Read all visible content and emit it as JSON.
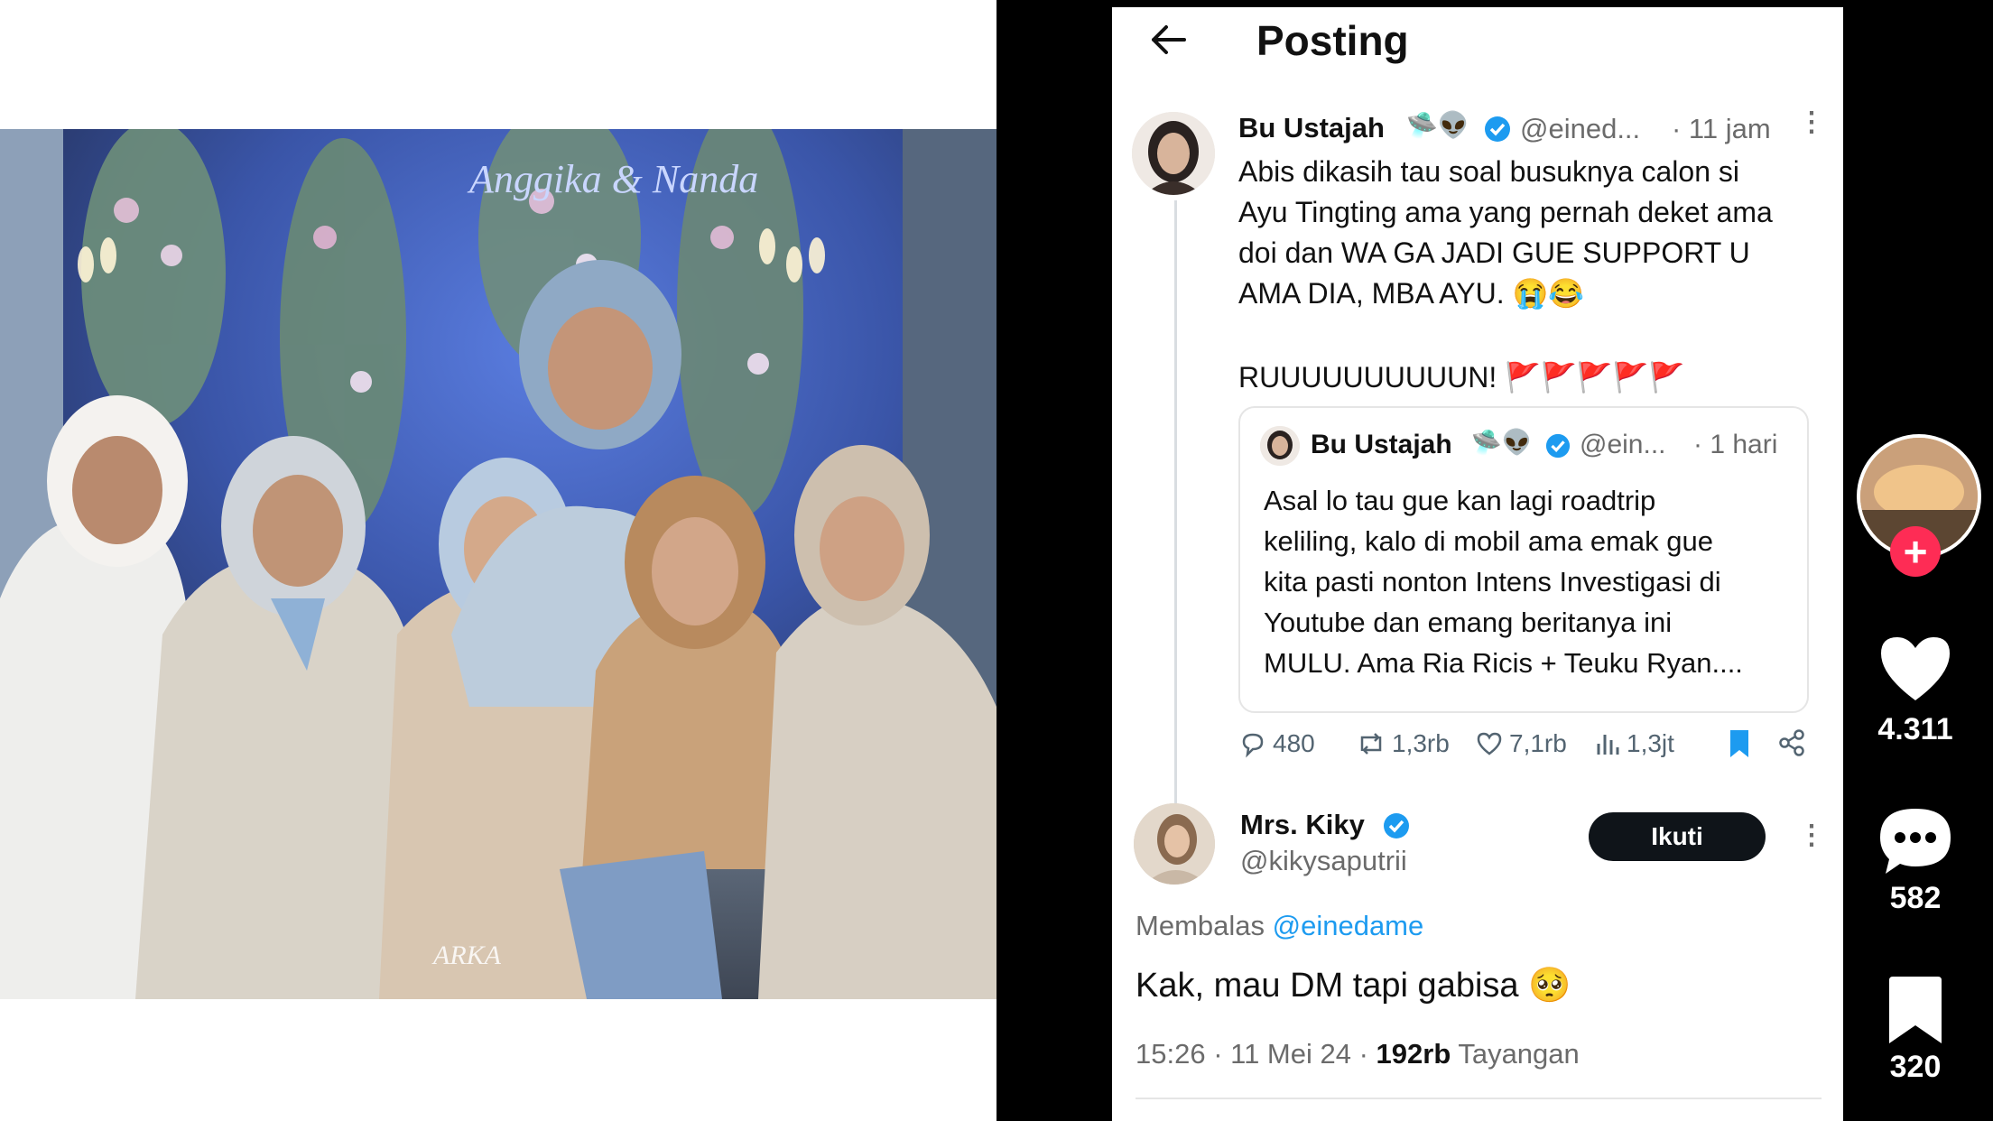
{
  "post": {
    "header_title": "Posting",
    "tweet1": {
      "display_name": "Bu Ustajah",
      "emoji": "🛸👽",
      "handle": "@eined...",
      "time": "· 11 jam",
      "body_lines": [
        "Abis dikasih tau soal busuknya calon si",
        "Ayu Tingting ama yang pernah deket ama",
        "doi dan WA GA JADI GUE SUPPORT U",
        "AMA DIA, MBA AYU. 😭😂"
      ],
      "body_last": "RUUUUUUUUUUN! 🚩🚩🚩🚩🚩"
    },
    "quote": {
      "display_name": "Bu Ustajah",
      "emoji": "🛸👽",
      "handle": "@ein...",
      "time": "· 1 hari",
      "body_lines": [
        "Asal lo tau gue kan lagi roadtrip",
        "keliling, kalo di mobil ama emak gue",
        "kita pasti nonton Intens Investigasi di",
        "Youtube dan emang beritanya ini",
        "MULU. Ama Ria Ricis + Teuku Ryan...."
      ]
    },
    "actions": {
      "replies": "480",
      "reposts": "1,3rb",
      "likes": "7,1rb",
      "views": "1,3jt"
    },
    "reply": {
      "display_name": "Mrs. Kiky",
      "handle": "@kikysaputrii",
      "follow_label": "Ikuti",
      "replying_prefix": "Membalas",
      "replying_to": "@einedame",
      "body": "Kak, mau DM tapi gabisa 🥺",
      "timestamp": "15:26 · 11 Mei 24 ·",
      "views_count": "192rb",
      "views_label": "Tayangan"
    }
  },
  "rail": {
    "likes": "4.311",
    "comments": "582",
    "saves": "320"
  },
  "photo": {
    "banner_text": "Anggika & Nanda",
    "watermark": "ARKA"
  },
  "colors": {
    "accent_blue": "#1d9bf0",
    "follow_dark": "#0f1419",
    "tiktok_red": "#fe2c55"
  }
}
